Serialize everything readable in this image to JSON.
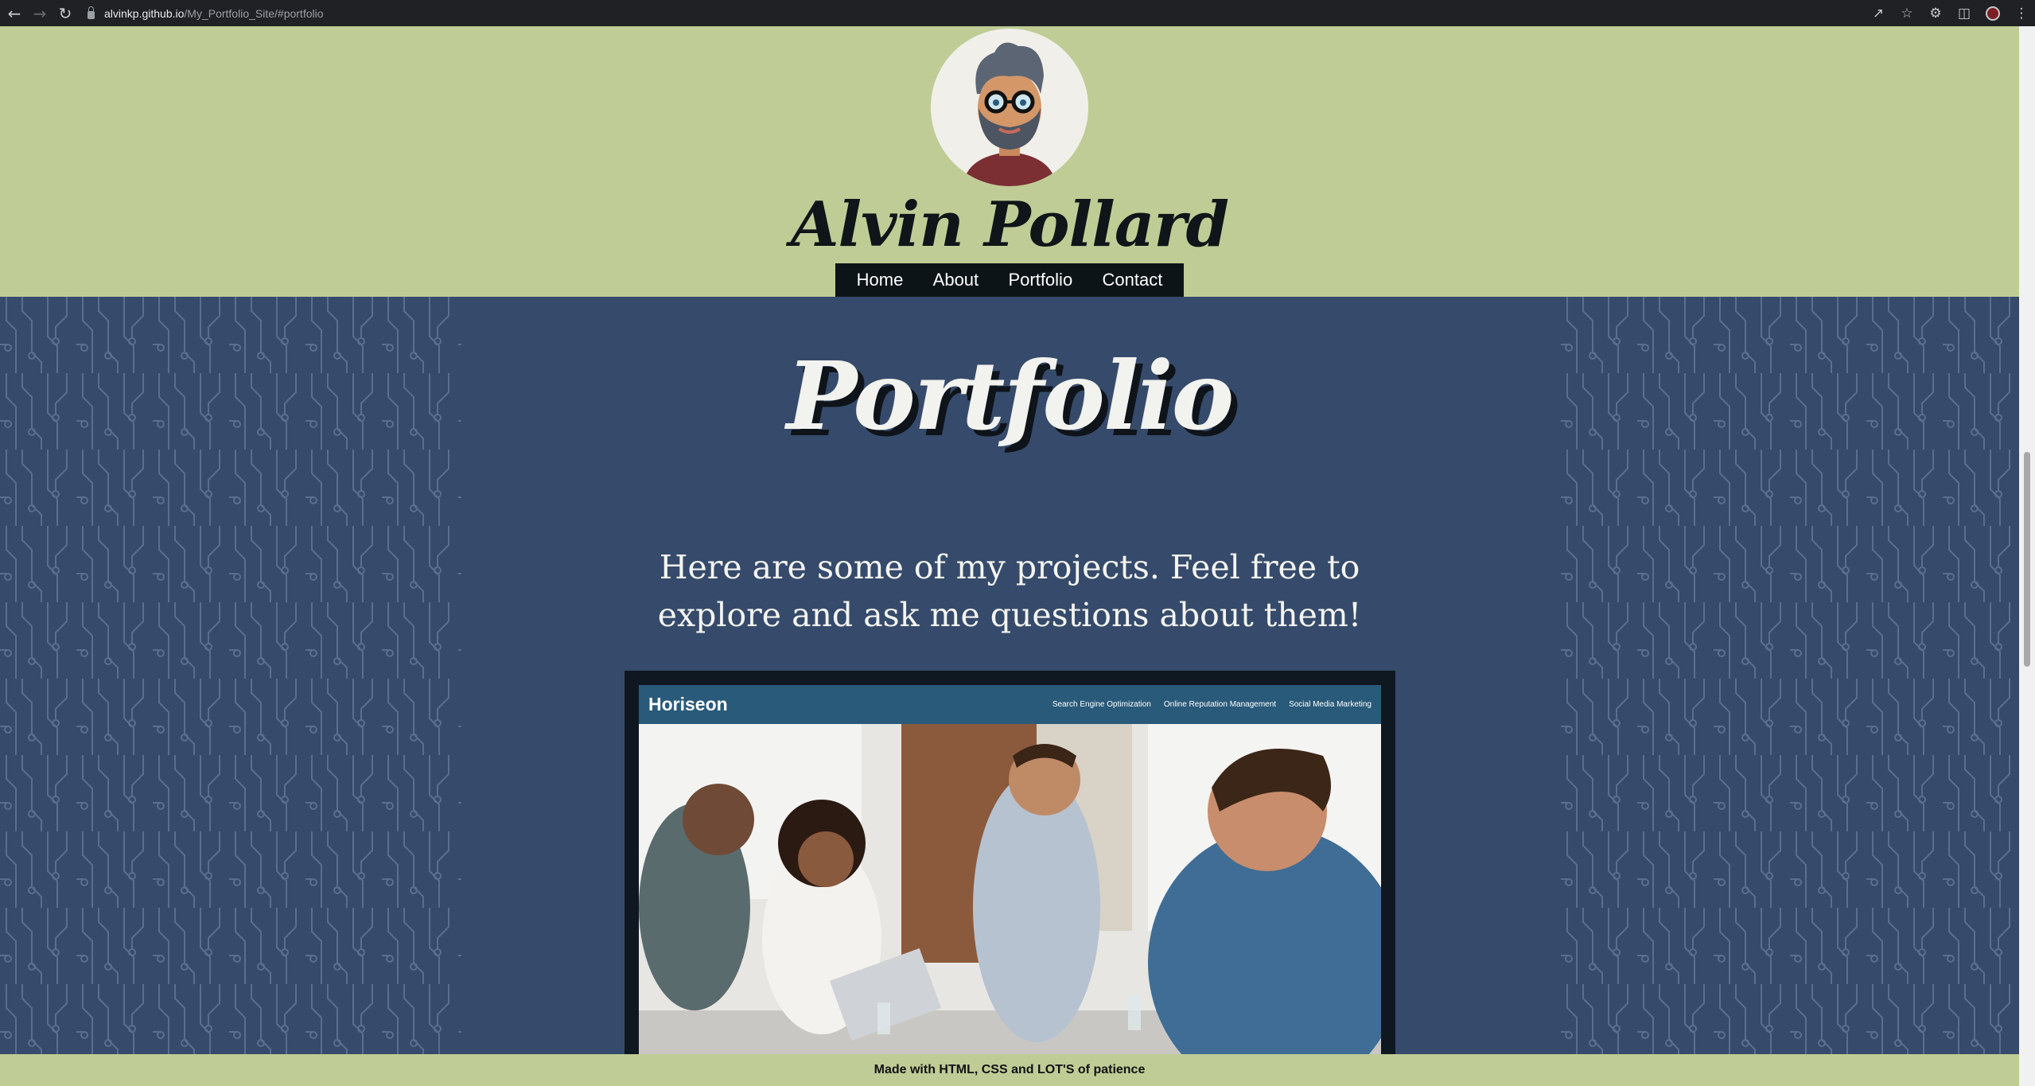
{
  "browser": {
    "url_host": "alvinkp.github.io",
    "url_path": "/My_Portfolio_Site/#portfolio",
    "back_icon": "arrow-left-icon",
    "forward_icon": "arrow-right-icon",
    "reload_icon": "reload-icon"
  },
  "header": {
    "name": "Alvin Pollard",
    "avatar": "cartoon-avatar"
  },
  "nav": {
    "items": [
      {
        "label": "Home"
      },
      {
        "label": "About"
      },
      {
        "label": "Portfolio"
      },
      {
        "label": "Contact"
      }
    ]
  },
  "portfolio": {
    "title": "Portfolio",
    "intro": "Here are some of my projects. Feel free to explore and ask me questions about them!",
    "project": {
      "brand": "Horiseon",
      "links": [
        "Search Engine Optimization",
        "Online Reputation Management",
        "Social Media Marketing"
      ]
    }
  },
  "footer": {
    "text": "Made with HTML, CSS and LOT'S of patience"
  },
  "colors": {
    "header_bg": "#bfcc96",
    "section_bg": "#364b6b",
    "nav_bg": "#0d1418",
    "project_header": "#2a5a79"
  }
}
